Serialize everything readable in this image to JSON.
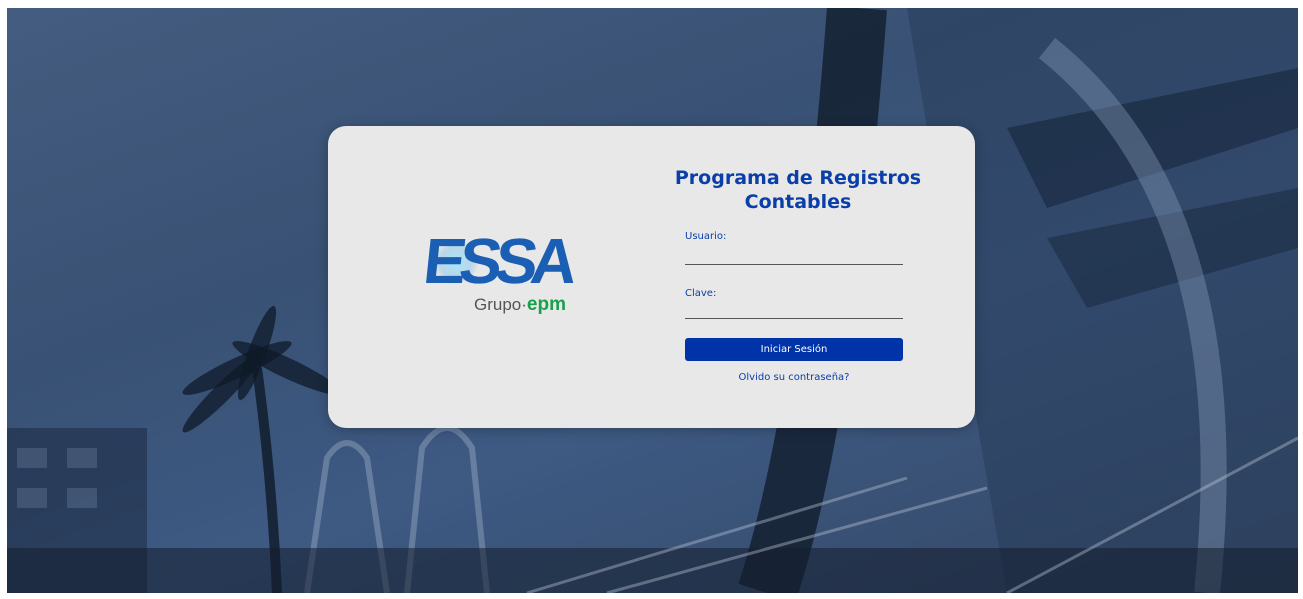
{
  "background": {
    "description_icon": "building-photo",
    "tint_color": "#2d4566"
  },
  "logo": {
    "brand": "ESSA",
    "subtitle_prefix": "Grupo·",
    "subtitle_brand": "epm",
    "brand_color": "#1a5fb4",
    "epm_color": "#1aa04a"
  },
  "login": {
    "title": "Programa de Registros Contables",
    "username_label": "Usuario:",
    "username_value": "",
    "password_label": "Clave:",
    "password_value": "",
    "submit_label": "Iniciar Sesión",
    "forgot_label": "Olvido su contraseña?",
    "accent_color": "#0033a8"
  }
}
